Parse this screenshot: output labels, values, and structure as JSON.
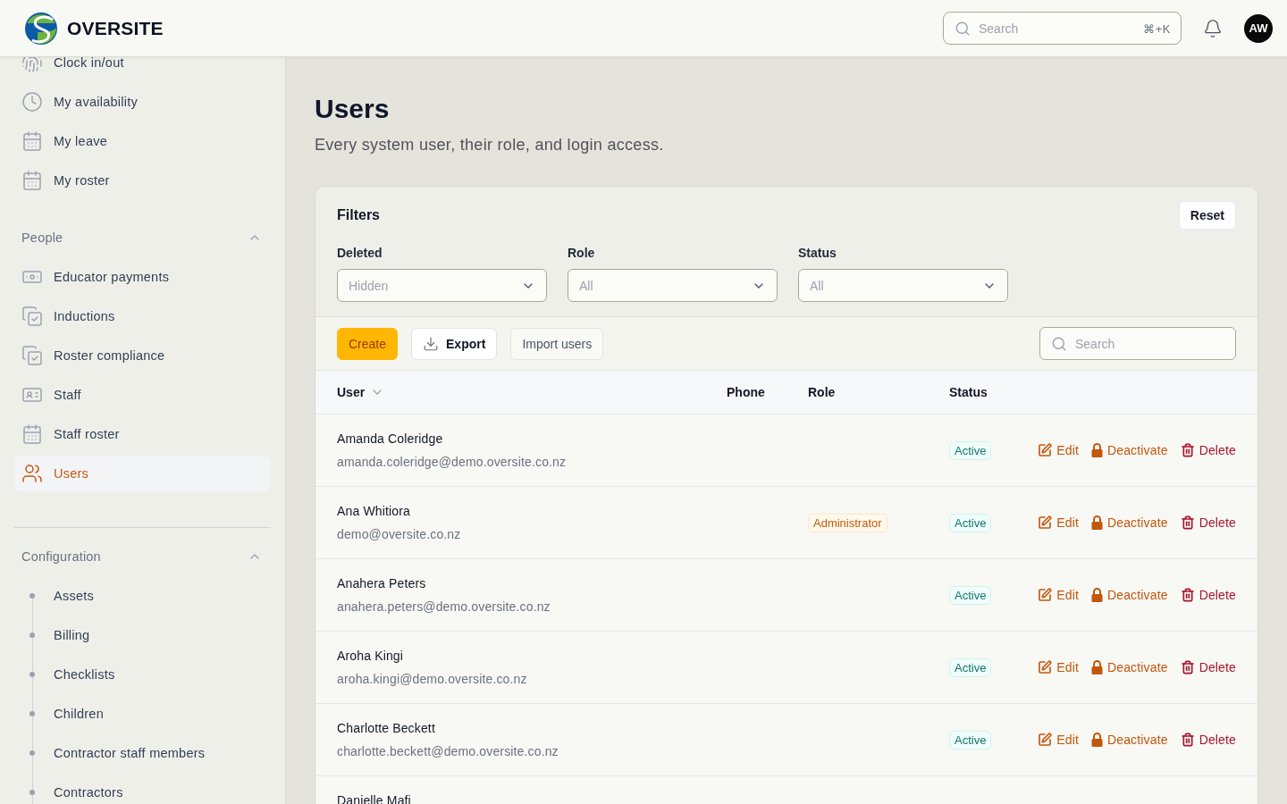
{
  "header": {
    "logo_text": "OVERSITE",
    "search": {
      "placeholder": "Search",
      "shortcut": "⌘+K"
    },
    "avatar": "AW"
  },
  "sidebar": {
    "sections": [
      {
        "kind": "icon-list",
        "items": [
          {
            "label": "Clock in/out",
            "selected": false
          },
          {
            "label": "My availability",
            "selected": false
          },
          {
            "label": "My leave",
            "selected": false
          },
          {
            "label": "My roster",
            "selected": false
          }
        ]
      },
      {
        "kind": "icon-list",
        "title": "People",
        "expanded": true,
        "items": [
          {
            "label": "Educator payments",
            "selected": false
          },
          {
            "label": "Inductions",
            "selected": false
          },
          {
            "label": "Roster compliance",
            "selected": false
          },
          {
            "label": "Staff",
            "selected": false
          },
          {
            "label": "Staff roster",
            "selected": false
          },
          {
            "label": "Users",
            "selected": true
          }
        ]
      },
      {
        "kind": "tree",
        "title": "Configuration",
        "expanded": true,
        "items": [
          {
            "label": "Assets",
            "selected": false
          },
          {
            "label": "Billing",
            "selected": false
          },
          {
            "label": "Checklists",
            "selected": false
          },
          {
            "label": "Children",
            "selected": false
          },
          {
            "label": "Contractor staff members",
            "selected": false
          },
          {
            "label": "Contractors",
            "selected": false
          }
        ]
      }
    ]
  },
  "page": {
    "title": "Users",
    "subtitle": "Every system user, their role, and login access."
  },
  "filters": {
    "title": "Filters",
    "reset": "Reset",
    "fields": [
      {
        "label": "Deleted",
        "placeholder": "Hidden"
      },
      {
        "label": "Role",
        "placeholder": "All"
      },
      {
        "label": "Status",
        "placeholder": "All"
      }
    ]
  },
  "toolbar": {
    "buttons": [
      {
        "kind": "primary",
        "label": "Create"
      },
      {
        "kind": "export",
        "label": "Export"
      },
      {
        "kind": "secondary",
        "label": "Import users"
      }
    ],
    "search": {
      "placeholder": "Search"
    }
  },
  "table": {
    "columns": [
      {
        "label": "User",
        "sorted": true
      },
      {
        "label": "Phone",
        "sorted": false
      },
      {
        "label": "Role",
        "sorted": false
      },
      {
        "label": "Status",
        "sorted": false
      }
    ],
    "rows": [
      {
        "name": "Amanda Coleridge",
        "email": "amanda.coleridge@demo.oversite.co.nz",
        "status": "Active",
        "actions": [
          {
            "kind": "edit",
            "label": "Edit"
          },
          {
            "kind": "deactivate",
            "label": "Deactivate"
          },
          {
            "kind": "delete",
            "label": "Delete"
          }
        ]
      },
      {
        "name": "Ana Whitiora",
        "email": "demo@oversite.co.nz",
        "role": "Administrator",
        "status": "Active",
        "actions": [
          {
            "kind": "edit",
            "label": "Edit"
          },
          {
            "kind": "deactivate",
            "label": "Deactivate"
          },
          {
            "kind": "delete",
            "label": "Delete"
          }
        ]
      },
      {
        "name": "Anahera Peters",
        "email": "anahera.peters@demo.oversite.co.nz",
        "status": "Active",
        "actions": [
          {
            "kind": "edit",
            "label": "Edit"
          },
          {
            "kind": "deactivate",
            "label": "Deactivate"
          },
          {
            "kind": "delete",
            "label": "Delete"
          }
        ]
      },
      {
        "name": "Aroha Kingi",
        "email": "aroha.kingi@demo.oversite.co.nz",
        "status": "Active",
        "actions": [
          {
            "kind": "edit",
            "label": "Edit"
          },
          {
            "kind": "deactivate",
            "label": "Deactivate"
          },
          {
            "kind": "delete",
            "label": "Delete"
          }
        ]
      },
      {
        "name": "Charlotte Beckett",
        "email": "charlotte.beckett@demo.oversite.co.nz",
        "status": "Active",
        "actions": [
          {
            "kind": "edit",
            "label": "Edit"
          },
          {
            "kind": "deactivate",
            "label": "Deactivate"
          },
          {
            "kind": "delete",
            "label": "Delete"
          }
        ]
      },
      {
        "name": "Danielle Mafi"
      }
    ]
  }
}
